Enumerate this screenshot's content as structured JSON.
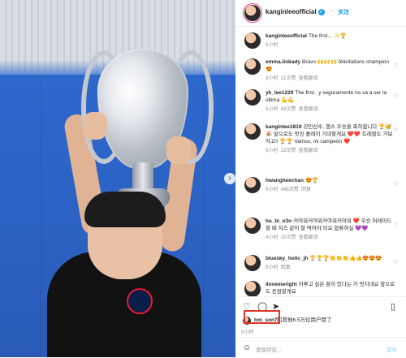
{
  "post": {
    "username": "kanginleeofficial",
    "follow_label": "关注",
    "caption_user": "kanginleeofficial",
    "caption_text": "The first... ✨🏆",
    "caption_time": "5小时"
  },
  "comments": [
    {
      "user": "emma.linkady",
      "text": "Bravo 🙌🙌🙌 félicitations champion 😍",
      "time": "3小时",
      "likes": "21次赞",
      "reply": "查看翻译"
    },
    {
      "user": "yk_lee1229",
      "text": "The first.. y seguramente no va a ser la última 💪💪",
      "time": "5小时",
      "likes": "43次赞",
      "reply": "查看翻译"
    },
    {
      "user": "kanginlee1819",
      "text": "강인선수, 챔스 우승을 축하합니다 🏆🥳🎉 앞으로도 멋진 플레이 기대할게요 ❤️❤️ 트레블도 가보자고!! 🏆🏆 Vamos, mi campeón ❤️",
      "time": "5小时",
      "likes": "22次赞",
      "reply": "查看翻译"
    },
    {
      "user": "hwangheechan",
      "text": "😍🏆",
      "time": "5小时",
      "likes": "448次赞",
      "reply": "回复"
    },
    {
      "user": "ha_bi_o3o",
      "text": "커여워커여워커여워커여워 ❤️ 우승 퍼레이드 할 때 치즈 같이 잘 먹어야 되요 합류하실 💜💜",
      "time": "4小时",
      "likes": "15次赞",
      "reply": "查看翻译"
    },
    {
      "user": "bluesky_holic_jh",
      "text": "🏆🏆🏆👏👏👏👍👍😍😍😍",
      "time": "5小时",
      "likes": "",
      "reply": "回复"
    },
    {
      "user": "ilovemeright",
      "text": "이루고 싶은 꿈이 있다는 거 멋지네요 앞으로도 응원할게요",
      "time": "",
      "likes": "",
      "reply": ""
    }
  ],
  "likes_line": {
    "name": "hm_son7",
    "rest": "和其他6.5万位用户赞了"
  },
  "date_text": "5小时",
  "add_comment": {
    "placeholder": "添加评论...",
    "post_label": "发布"
  },
  "icons": {
    "like": "heart-icon",
    "comment": "comment-icon",
    "share": "share-icon",
    "save": "bookmark-icon",
    "next": "chevron-right-icon",
    "emoji": "emoji-icon"
  },
  "colors": {
    "accent": "#0095f6",
    "highlight_box": "#e3362a"
  }
}
